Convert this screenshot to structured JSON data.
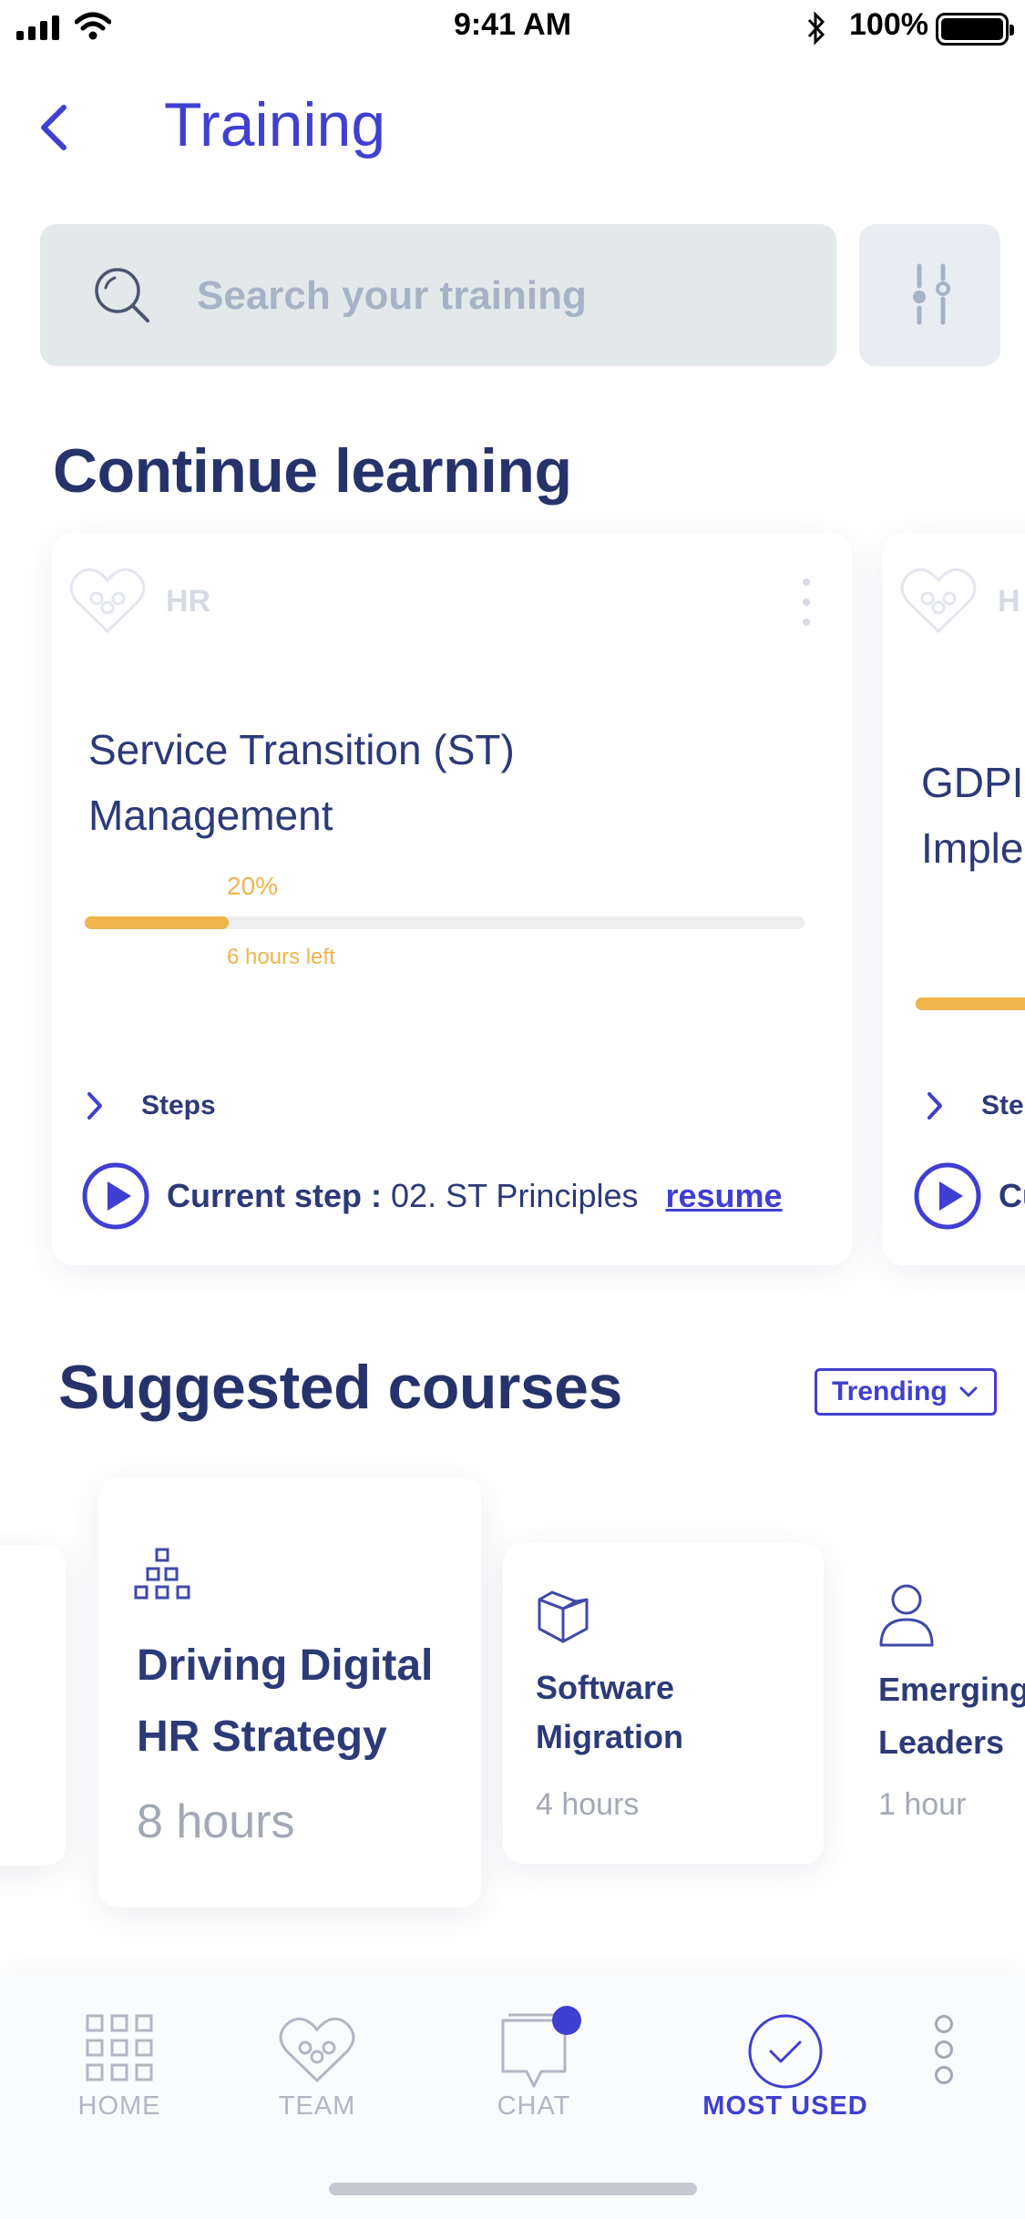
{
  "status_bar": {
    "time": "9:41 AM",
    "battery": "100%"
  },
  "header": {
    "title": "Training"
  },
  "search": {
    "placeholder": "Search your training"
  },
  "continue_learning": {
    "heading": "Continue learning",
    "cards": [
      {
        "category": "HR",
        "title": "Service Transition (ST) Management",
        "progress_label": "20%",
        "progress": 0.2,
        "time_left": "6 hours left",
        "steps_label": "Steps",
        "current_step_label": "Current step",
        "current_step_value": "02. ST Principles",
        "resume_label": "resume"
      },
      {
        "category": "H",
        "title": "GDPI Imple",
        "steps_label": "Ste",
        "current_step_label": "Cu"
      }
    ]
  },
  "suggested": {
    "heading": "Suggested courses",
    "filter": {
      "selected": "Trending"
    },
    "cards": [
      {
        "icon": "hierarchy-icon",
        "title": "Driving Digital HR Strategy",
        "duration": "8 hours"
      },
      {
        "icon": "box-icon",
        "title": "Software Migration",
        "duration": "4 hours"
      },
      {
        "icon": "person-icon",
        "title": "Emerging Leaders",
        "duration": "1 hour"
      }
    ]
  },
  "nav": {
    "items": [
      {
        "label": "HOME",
        "icon": "grid-icon"
      },
      {
        "label": "TEAM",
        "icon": "team-heart-icon"
      },
      {
        "label": "CHAT",
        "icon": "chat-icon"
      },
      {
        "label": "MOST USED",
        "icon": "check-circle-icon"
      }
    ],
    "more_icon": "more-vertical-icon"
  },
  "colors": {
    "accent": "#3f3fd1",
    "heading": "#26336b",
    "progress": "#f0b44c",
    "muted": "#a3a8b6"
  }
}
